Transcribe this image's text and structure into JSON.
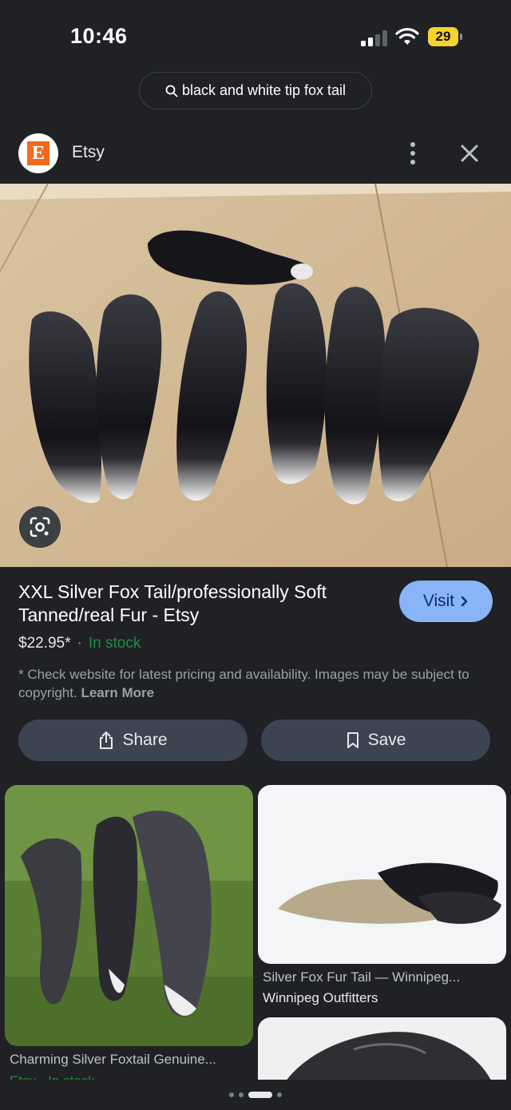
{
  "status_bar": {
    "time": "10:46",
    "battery": "29"
  },
  "search": {
    "query": "black and white tip fox tail"
  },
  "source": {
    "name": "Etsy",
    "favicon_letter": "E",
    "favicon_color": "#ef6a1d"
  },
  "product": {
    "title_line1": "XXL Silver Fox Tail/professionally Soft",
    "title_line2": "Tanned/real Fur - Etsy",
    "price": "$22.95*",
    "separator": "·",
    "stock": "In stock",
    "disclaimer": "* Check website for latest pricing and availability. Images may be subject to copyright.",
    "learn_more": "Learn More"
  },
  "buttons": {
    "visit": "Visit",
    "share": "Share",
    "save": "Save"
  },
  "related": [
    {
      "caption": "Charming Silver Foxtail Genuine...",
      "source": "Etsy · In stock"
    },
    {
      "caption": "Silver Fox Fur Tail — Winnipeg...",
      "source": "Winnipeg Outfitters"
    }
  ],
  "colors": {
    "accent": "#8ab4f8",
    "in_stock": "#1e8e3e",
    "background": "#202124",
    "button_bg": "#3c4452"
  }
}
